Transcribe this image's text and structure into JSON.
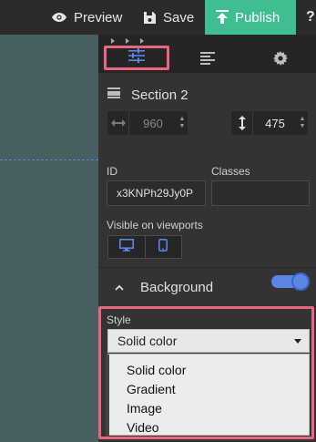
{
  "toolbar": {
    "preview_label": "Preview",
    "save_label": "Save",
    "publish_label": "Publish",
    "help_label": "?"
  },
  "panel": {
    "tabs": [
      "style",
      "layers",
      "settings"
    ],
    "active_tab": "style",
    "section_title": "Section 2",
    "width_value": "960",
    "height_value": "475",
    "id_label": "ID",
    "id_value": "x3KNPh29Jy0P",
    "classes_label": "Classes",
    "classes_value": "",
    "viewports_label": "Visible on viewports",
    "viewports": [
      "desktop",
      "mobile"
    ],
    "background_label": "Background",
    "background_enabled": true,
    "style_label": "Style",
    "style_selected": "Solid color",
    "style_options": [
      "Solid color",
      "Gradient",
      "Image",
      "Video"
    ]
  },
  "colors": {
    "canvas": "#475f5f",
    "panel": "#333333",
    "accent_blue": "#5b86e6",
    "publish_green": "#3fbf8f",
    "highlight_pink": "#e8677f"
  }
}
